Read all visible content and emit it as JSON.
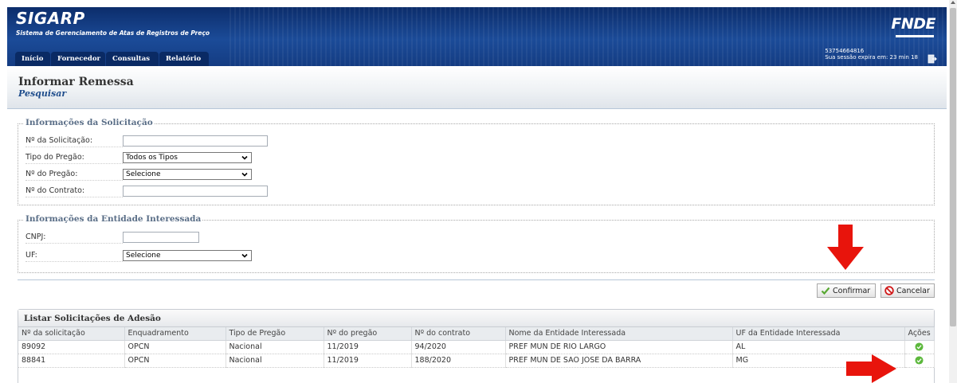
{
  "header": {
    "app_name": "SIGARP",
    "app_subtitle": "Sistema de Gerenciamento de Atas de Registros de Preço",
    "brand": "FNDE",
    "user_id": "53754664816",
    "session_text": "Sua sessão expira em: 23 min 18",
    "tabs": [
      "Início",
      "Fornecedor",
      "Consultas",
      "Relatório"
    ]
  },
  "page": {
    "title": "Informar Remessa",
    "subtitle": "Pesquisar"
  },
  "solicitacao": {
    "legend": "Informações da Solicitação",
    "numero_label": "Nº da Solicitação:",
    "numero_value": "",
    "tipo_label": "Tipo do Pregão:",
    "tipo_value": "Todos os Tipos",
    "pregao_label": "Nº do Pregão:",
    "pregao_value": "Selecione",
    "contrato_label": "Nº do Contrato:",
    "contrato_value": ""
  },
  "entidade": {
    "legend": "Informações da Entidade Interessada",
    "cnpj_label": "CNPJ:",
    "cnpj_value": "",
    "uf_label": "UF:",
    "uf_value": "Selecione"
  },
  "buttons": {
    "confirm": "Confirmar",
    "cancel": "Cancelar"
  },
  "list": {
    "title": "Listar Solicitações de Adesão",
    "columns": [
      "Nº da solicitação",
      "Enquadramento",
      "Tipo de Pregão",
      "Nº do pregão",
      "Nº do contrato",
      "Nome da Entidade Interessada",
      "UF da Entidade Interessada",
      "Ações"
    ],
    "rows": [
      [
        "89092",
        "OPCN",
        "Nacional",
        "11/2019",
        "94/2020",
        "PREF MUN DE RIO LARGO",
        "AL"
      ],
      [
        "88841",
        "OPCN",
        "Nacional",
        "11/2019",
        "188/2020",
        "PREF MUN DE SAO JOSE DA BARRA",
        "MG"
      ]
    ]
  },
  "colors": {
    "header_blue": "#1b4b98",
    "arrow_red": "#e8140c",
    "ok_green": "#5cb83c"
  }
}
